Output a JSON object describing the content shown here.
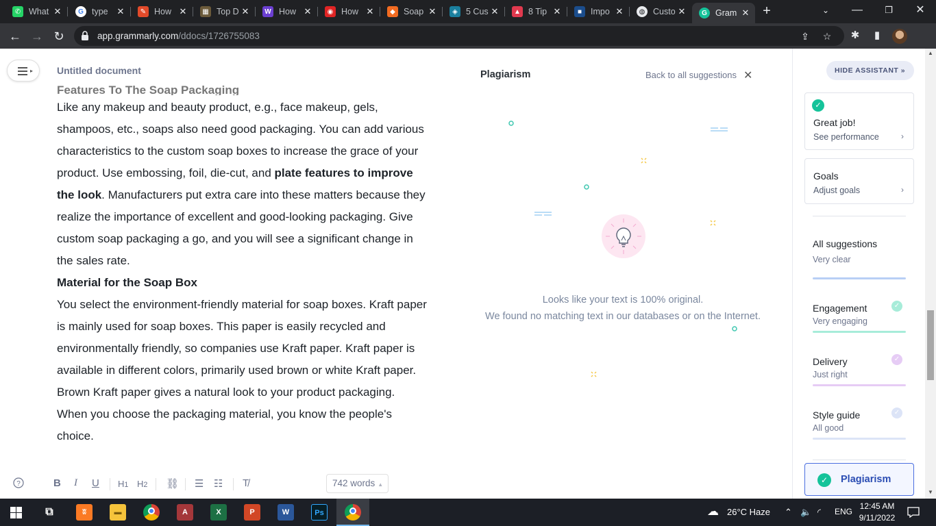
{
  "browser": {
    "tabs": [
      {
        "label": "What",
        "fav_color": "#25d366",
        "fav_glyph": "✆"
      },
      {
        "label": "type",
        "fav_color": "#4285f4",
        "fav_glyph": "G"
      },
      {
        "label": "How",
        "fav_color": "#e24a2a",
        "fav_glyph": "✎"
      },
      {
        "label": "Top D",
        "fav_color": "#6b5a3a",
        "fav_glyph": "▦"
      },
      {
        "label": "How",
        "fav_color": "#6b3fd1",
        "fav_glyph": "W"
      },
      {
        "label": "How",
        "fav_color": "#e02424",
        "fav_glyph": "◉"
      },
      {
        "label": "Soap",
        "fav_color": "#f26b21",
        "fav_glyph": "◆"
      },
      {
        "label": "5 Cus",
        "fav_color": "#1a7f9e",
        "fav_glyph": "◈"
      },
      {
        "label": "8 Tip",
        "fav_color": "#e0394e",
        "fav_glyph": "▲"
      },
      {
        "label": "Impo",
        "fav_color": "#1b4d8c",
        "fav_glyph": "■"
      },
      {
        "label": "Custo",
        "fav_color": "#9aa0a6",
        "fav_glyph": "◍"
      },
      {
        "label": "Gram",
        "fav_color": "#15c39a",
        "fav_glyph": "G"
      }
    ],
    "url_host": "app.grammarly.com",
    "url_path": "/ddocs/1726755083"
  },
  "document": {
    "title": "Untitled document",
    "heading_cut": "Features To The Soap Packaging",
    "para1_a": "Like any makeup and beauty product, e.g., face makeup, gels, shampoos, etc., soaps also need good packaging. You can add various characteristics to the custom soap boxes to increase the grace of your product. Use embossing, foil, die-cut, and ",
    "para1_bold": "plate features to improve the look",
    "para1_b": ". Manufacturers put extra care into these matters because they realize the importance of excellent and good-looking packaging. Give custom soap packaging a go, and you will see a significant change in the sales rate.",
    "heading2": "Material for the Soap Box",
    "para2": "You select the environment-friendly material for soap boxes. Kraft paper is mainly used for soap boxes. This paper is easily recycled and environmentally friendly, so companies use Kraft paper. Kraft paper is available in different colors, primarily used brown or white Kraft paper. Brown Kraft paper gives a natural look to your product packaging. When you choose the packaging material, you know the people's choice.",
    "word_count": "742 words"
  },
  "plagiarism": {
    "title": "Plagiarism",
    "back_label": "Back to all suggestions",
    "line1": "Looks like your text is 100% original.",
    "line2": "We found no matching text in our databases or on the Internet."
  },
  "assistant": {
    "hide_label": "HIDE ASSISTANT",
    "card1_title": "Great job!",
    "card1_sub": "See performance",
    "card2_title": "Goals",
    "card2_sub": "Adjust goals",
    "all_suggestions": "All suggestions",
    "goals": [
      {
        "label": "",
        "status": "Very clear",
        "color": "#b8cff5"
      },
      {
        "label": "Engagement",
        "status": "Very engaging",
        "color": "#a7ecd9"
      },
      {
        "label": "Delivery",
        "status": "Just right",
        "color": "#e6ccf5"
      },
      {
        "label": "Style guide",
        "status": "All good",
        "color": "#dce4f7"
      }
    ],
    "plag_label": "Plagiarism"
  },
  "taskbar": {
    "weather": "26°C  Haze",
    "lang": "ENG",
    "time": "12:45 AM",
    "date": "9/11/2022"
  }
}
